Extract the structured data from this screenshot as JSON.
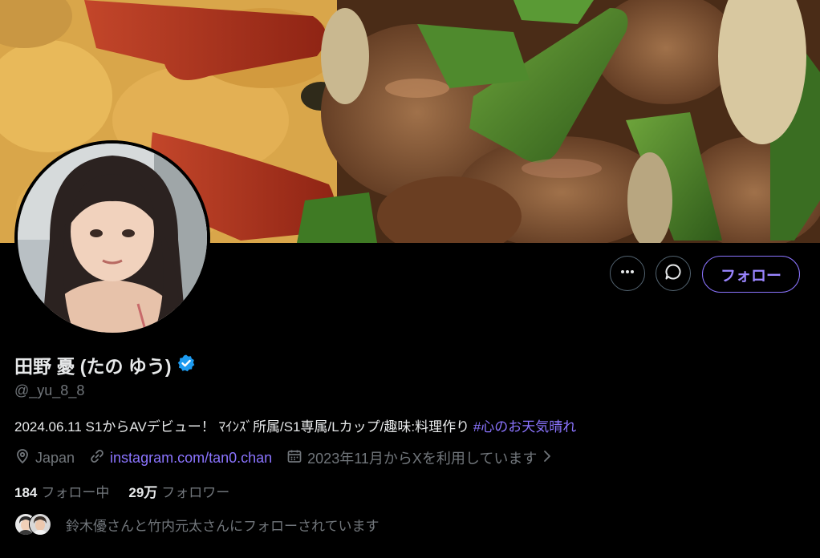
{
  "banner": {
    "description_icon": "food-banner-image"
  },
  "avatar": {
    "icon": "profile-avatar"
  },
  "actions": {
    "more_icon": "more-icon",
    "message_icon": "message-icon",
    "follow_label": "フォロー"
  },
  "profile": {
    "display_name": "田野 憂 (たの ゆう)",
    "verified_icon": "verified-badge-icon",
    "handle": "@_yu_8_8",
    "bio_text": "2024.06.11 S1からAVデビュー！ ﾏｲﾝｽﾞ所属/S1専属/Lカップ/趣味:料理作り ",
    "bio_hashtag": "#心のお天気晴れ",
    "location": "Japan",
    "website": "instagram.com/tan0.chan",
    "joined": "2023年11月からXを利用しています"
  },
  "stats": {
    "following_count": "184",
    "following_label": "フォロー中",
    "followers_count": "29万",
    "followers_label": "フォロワー"
  },
  "followed_by": {
    "text": "鈴木優さんと竹内元太さんにフォローされています"
  },
  "colors": {
    "accent": "#8b74ff",
    "muted": "#71767b",
    "text": "#e7e9ea",
    "verified": "#1d9bf0"
  }
}
